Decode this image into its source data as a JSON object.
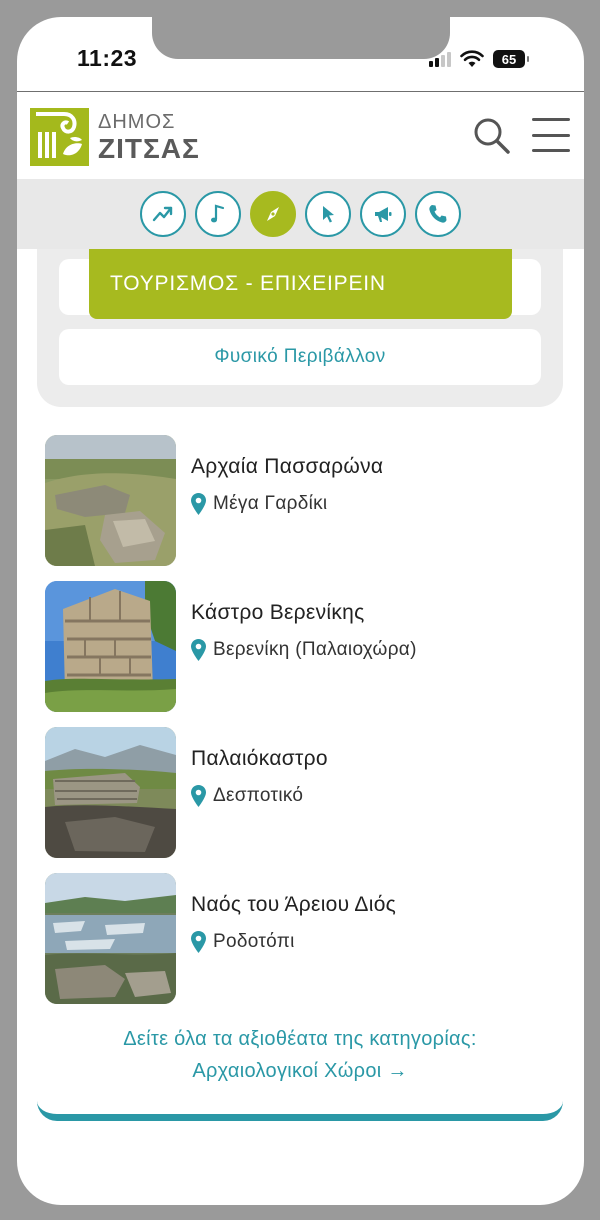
{
  "status_bar": {
    "time": "11:23",
    "battery": "65"
  },
  "logo": {
    "line1": "ΔΗΜΟΣ",
    "line2": "ΖΙΤΣΑΣ"
  },
  "icons": [
    "trending-icon",
    "music-note-icon",
    "compass-icon",
    "cursor-icon",
    "megaphone-icon",
    "phone-icon"
  ],
  "category": {
    "title": "ΤΟΥΡΙΣΜΟΣ - ΕΠΙΧΕΙΡΕΙΝ",
    "subcategory": "Φυσικό Περιβάλλον"
  },
  "items": [
    {
      "title": "Αρχαία Πασσαρώνα",
      "location": "Μέγα Γαρδίκι"
    },
    {
      "title": "Κάστρο Βερενίκης",
      "location": "Βερενίκη (Παλαιοχώρα)"
    },
    {
      "title": "Παλαιόκαστρο",
      "location": "Δεσποτικό"
    },
    {
      "title": "Ναός του Άρειου Διός",
      "location": "Ροδοτόπι"
    }
  ],
  "see_all": {
    "line1": "Δείτε όλα τα αξιοθέατα της κατηγορίας:",
    "line2": "Αρχαιολογικοί Χώροι →"
  },
  "colors": {
    "accent_green": "#a7ba1f",
    "accent_teal": "#2a98a6"
  }
}
